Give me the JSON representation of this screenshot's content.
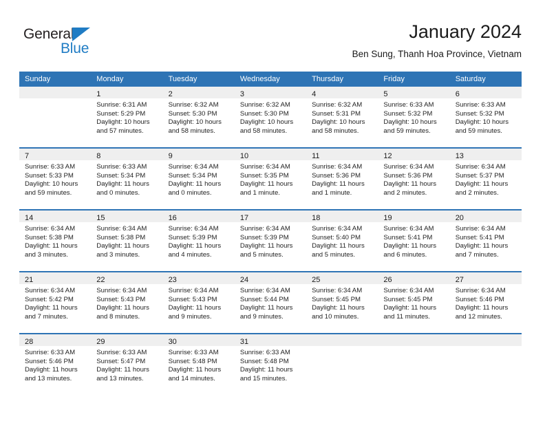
{
  "brand": {
    "name_top": "General",
    "name_bottom": "Blue",
    "accent_color": "#1f7cc4"
  },
  "header": {
    "title": "January 2024",
    "subtitle": "Ben Sung, Thanh Hoa Province, Vietnam"
  },
  "theme": {
    "header_blue": "#2e74b5",
    "daynum_strip": "#efefef",
    "text": "#222222"
  },
  "weekday_headers": [
    "Sunday",
    "Monday",
    "Tuesday",
    "Wednesday",
    "Thursday",
    "Friday",
    "Saturday"
  ],
  "weeks": [
    [
      {
        "day": ""
      },
      {
        "day": "1",
        "sunrise": "Sunrise: 6:31 AM",
        "sunset": "Sunset: 5:29 PM",
        "daylight_1": "Daylight: 10 hours",
        "daylight_2": "and 57 minutes."
      },
      {
        "day": "2",
        "sunrise": "Sunrise: 6:32 AM",
        "sunset": "Sunset: 5:30 PM",
        "daylight_1": "Daylight: 10 hours",
        "daylight_2": "and 58 minutes."
      },
      {
        "day": "3",
        "sunrise": "Sunrise: 6:32 AM",
        "sunset": "Sunset: 5:30 PM",
        "daylight_1": "Daylight: 10 hours",
        "daylight_2": "and 58 minutes."
      },
      {
        "day": "4",
        "sunrise": "Sunrise: 6:32 AM",
        "sunset": "Sunset: 5:31 PM",
        "daylight_1": "Daylight: 10 hours",
        "daylight_2": "and 58 minutes."
      },
      {
        "day": "5",
        "sunrise": "Sunrise: 6:33 AM",
        "sunset": "Sunset: 5:32 PM",
        "daylight_1": "Daylight: 10 hours",
        "daylight_2": "and 59 minutes."
      },
      {
        "day": "6",
        "sunrise": "Sunrise: 6:33 AM",
        "sunset": "Sunset: 5:32 PM",
        "daylight_1": "Daylight: 10 hours",
        "daylight_2": "and 59 minutes."
      }
    ],
    [
      {
        "day": "7",
        "sunrise": "Sunrise: 6:33 AM",
        "sunset": "Sunset: 5:33 PM",
        "daylight_1": "Daylight: 10 hours",
        "daylight_2": "and 59 minutes."
      },
      {
        "day": "8",
        "sunrise": "Sunrise: 6:33 AM",
        "sunset": "Sunset: 5:34 PM",
        "daylight_1": "Daylight: 11 hours",
        "daylight_2": "and 0 minutes."
      },
      {
        "day": "9",
        "sunrise": "Sunrise: 6:34 AM",
        "sunset": "Sunset: 5:34 PM",
        "daylight_1": "Daylight: 11 hours",
        "daylight_2": "and 0 minutes."
      },
      {
        "day": "10",
        "sunrise": "Sunrise: 6:34 AM",
        "sunset": "Sunset: 5:35 PM",
        "daylight_1": "Daylight: 11 hours",
        "daylight_2": "and 1 minute."
      },
      {
        "day": "11",
        "sunrise": "Sunrise: 6:34 AM",
        "sunset": "Sunset: 5:36 PM",
        "daylight_1": "Daylight: 11 hours",
        "daylight_2": "and 1 minute."
      },
      {
        "day": "12",
        "sunrise": "Sunrise: 6:34 AM",
        "sunset": "Sunset: 5:36 PM",
        "daylight_1": "Daylight: 11 hours",
        "daylight_2": "and 2 minutes."
      },
      {
        "day": "13",
        "sunrise": "Sunrise: 6:34 AM",
        "sunset": "Sunset: 5:37 PM",
        "daylight_1": "Daylight: 11 hours",
        "daylight_2": "and 2 minutes."
      }
    ],
    [
      {
        "day": "14",
        "sunrise": "Sunrise: 6:34 AM",
        "sunset": "Sunset: 5:38 PM",
        "daylight_1": "Daylight: 11 hours",
        "daylight_2": "and 3 minutes."
      },
      {
        "day": "15",
        "sunrise": "Sunrise: 6:34 AM",
        "sunset": "Sunset: 5:38 PM",
        "daylight_1": "Daylight: 11 hours",
        "daylight_2": "and 3 minutes."
      },
      {
        "day": "16",
        "sunrise": "Sunrise: 6:34 AM",
        "sunset": "Sunset: 5:39 PM",
        "daylight_1": "Daylight: 11 hours",
        "daylight_2": "and 4 minutes."
      },
      {
        "day": "17",
        "sunrise": "Sunrise: 6:34 AM",
        "sunset": "Sunset: 5:39 PM",
        "daylight_1": "Daylight: 11 hours",
        "daylight_2": "and 5 minutes."
      },
      {
        "day": "18",
        "sunrise": "Sunrise: 6:34 AM",
        "sunset": "Sunset: 5:40 PM",
        "daylight_1": "Daylight: 11 hours",
        "daylight_2": "and 5 minutes."
      },
      {
        "day": "19",
        "sunrise": "Sunrise: 6:34 AM",
        "sunset": "Sunset: 5:41 PM",
        "daylight_1": "Daylight: 11 hours",
        "daylight_2": "and 6 minutes."
      },
      {
        "day": "20",
        "sunrise": "Sunrise: 6:34 AM",
        "sunset": "Sunset: 5:41 PM",
        "daylight_1": "Daylight: 11 hours",
        "daylight_2": "and 7 minutes."
      }
    ],
    [
      {
        "day": "21",
        "sunrise": "Sunrise: 6:34 AM",
        "sunset": "Sunset: 5:42 PM",
        "daylight_1": "Daylight: 11 hours",
        "daylight_2": "and 7 minutes."
      },
      {
        "day": "22",
        "sunrise": "Sunrise: 6:34 AM",
        "sunset": "Sunset: 5:43 PM",
        "daylight_1": "Daylight: 11 hours",
        "daylight_2": "and 8 minutes."
      },
      {
        "day": "23",
        "sunrise": "Sunrise: 6:34 AM",
        "sunset": "Sunset: 5:43 PM",
        "daylight_1": "Daylight: 11 hours",
        "daylight_2": "and 9 minutes."
      },
      {
        "day": "24",
        "sunrise": "Sunrise: 6:34 AM",
        "sunset": "Sunset: 5:44 PM",
        "daylight_1": "Daylight: 11 hours",
        "daylight_2": "and 9 minutes."
      },
      {
        "day": "25",
        "sunrise": "Sunrise: 6:34 AM",
        "sunset": "Sunset: 5:45 PM",
        "daylight_1": "Daylight: 11 hours",
        "daylight_2": "and 10 minutes."
      },
      {
        "day": "26",
        "sunrise": "Sunrise: 6:34 AM",
        "sunset": "Sunset: 5:45 PM",
        "daylight_1": "Daylight: 11 hours",
        "daylight_2": "and 11 minutes."
      },
      {
        "day": "27",
        "sunrise": "Sunrise: 6:34 AM",
        "sunset": "Sunset: 5:46 PM",
        "daylight_1": "Daylight: 11 hours",
        "daylight_2": "and 12 minutes."
      }
    ],
    [
      {
        "day": "28",
        "sunrise": "Sunrise: 6:33 AM",
        "sunset": "Sunset: 5:46 PM",
        "daylight_1": "Daylight: 11 hours",
        "daylight_2": "and 13 minutes."
      },
      {
        "day": "29",
        "sunrise": "Sunrise: 6:33 AM",
        "sunset": "Sunset: 5:47 PM",
        "daylight_1": "Daylight: 11 hours",
        "daylight_2": "and 13 minutes."
      },
      {
        "day": "30",
        "sunrise": "Sunrise: 6:33 AM",
        "sunset": "Sunset: 5:48 PM",
        "daylight_1": "Daylight: 11 hours",
        "daylight_2": "and 14 minutes."
      },
      {
        "day": "31",
        "sunrise": "Sunrise: 6:33 AM",
        "sunset": "Sunset: 5:48 PM",
        "daylight_1": "Daylight: 11 hours",
        "daylight_2": "and 15 minutes."
      },
      {
        "day": ""
      },
      {
        "day": ""
      },
      {
        "day": ""
      }
    ]
  ]
}
